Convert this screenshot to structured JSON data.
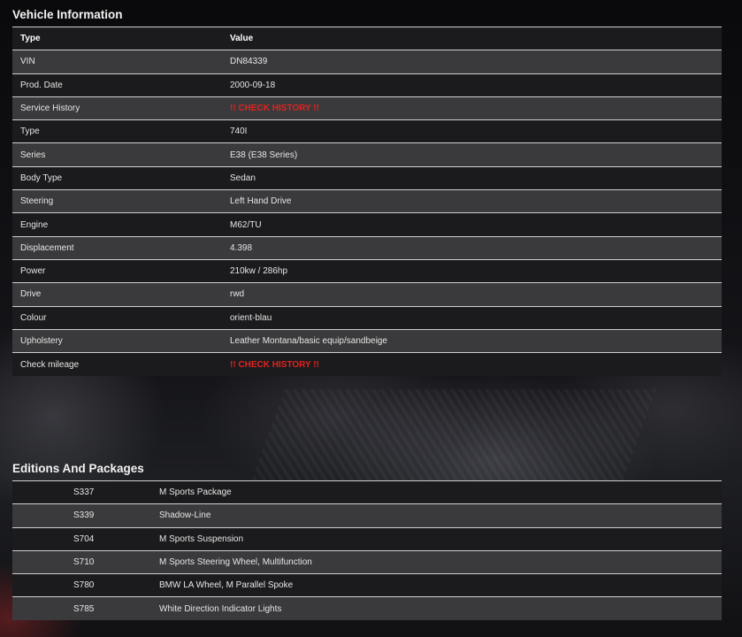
{
  "vehicle_info": {
    "title": "Vehicle Information",
    "columns": [
      "Type",
      "Value"
    ],
    "rows": [
      {
        "label": "VIN",
        "value": "DN84339"
      },
      {
        "label": "Prod. Date",
        "value": "2000-09-18"
      },
      {
        "label": "Service History",
        "value": "!! CHECK HISTORY !!"
      },
      {
        "label": "Type",
        "value": "740I"
      },
      {
        "label": "Series",
        "value": "E38 (E38 Series)"
      },
      {
        "label": "Body Type",
        "value": "Sedan"
      },
      {
        "label": "Steering",
        "value": "Left Hand Drive"
      },
      {
        "label": "Engine",
        "value": "M62/TU"
      },
      {
        "label": "Displacement",
        "value": "4.398"
      },
      {
        "label": "Power",
        "value": "210kw / 286hp"
      },
      {
        "label": "Drive",
        "value": "rwd"
      },
      {
        "label": "Colour",
        "value": "orient-blau"
      },
      {
        "label": "Upholstery",
        "value": "Leather Montana/basic equip/sandbeige"
      },
      {
        "label": "Check mileage",
        "value": "!! CHECK HISTORY !!"
      }
    ]
  },
  "editions": {
    "title": "Editions And Packages",
    "rows": [
      {
        "code": "S337",
        "name": "M Sports Package"
      },
      {
        "code": "S339",
        "name": "Shadow-Line"
      },
      {
        "code": "S704",
        "name": "M Sports Suspension"
      },
      {
        "code": "S710",
        "name": "M Sports Steering Wheel, Multifunction"
      },
      {
        "code": "S780",
        "name": "BMW LA Wheel, M Parallel Spoke"
      },
      {
        "code": "S785",
        "name": "White Direction Indicator Lights"
      }
    ]
  },
  "colors": {
    "warning": "#e0231f",
    "row_dark": "#1b1b1d",
    "row_light": "#3a3a3c"
  }
}
